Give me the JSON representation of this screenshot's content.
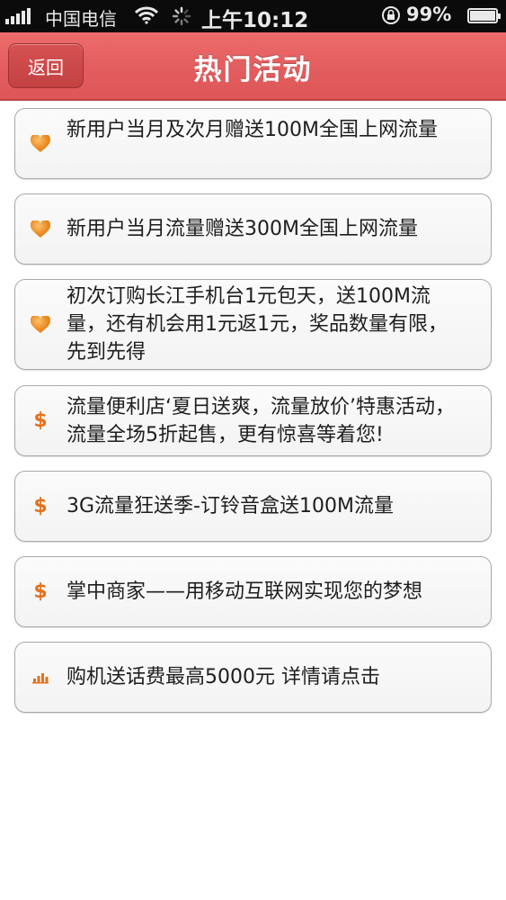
{
  "status_bar": {
    "carrier": "中国电信",
    "time": "上午10:12",
    "battery_percent": "99%",
    "battery_level": 0.99
  },
  "nav": {
    "back_label": "返回",
    "title": "热门活动",
    "bar_color": "#e45f60"
  },
  "activities": [
    {
      "icon": "heart-icon",
      "text": "新用户当月及次月赠送100M全国上网流量"
    },
    {
      "icon": "heart-icon",
      "text": "新用户当月流量赠送300M全国上网流量"
    },
    {
      "icon": "heart-icon",
      "text": "初次订购长江手机台1元包天，送100M流量，还有机会用1元返1元，奖品数量有限，先到先得"
    },
    {
      "icon": "dollar-icon",
      "text": "流量便利店‘夏日送爽，流量放价’特惠活动，流量全场5折起售，更有惊喜等着您!"
    },
    {
      "icon": "dollar-icon",
      "text": "3G流量狂送季-订铃音盒送100M流量"
    },
    {
      "icon": "dollar-icon",
      "text": "掌中商家——用移动互联网实现您的梦想"
    },
    {
      "icon": "bar-chart-icon",
      "text": "购机送话费最高5000元 详情请点击"
    }
  ],
  "accent_color": "#e3721e"
}
